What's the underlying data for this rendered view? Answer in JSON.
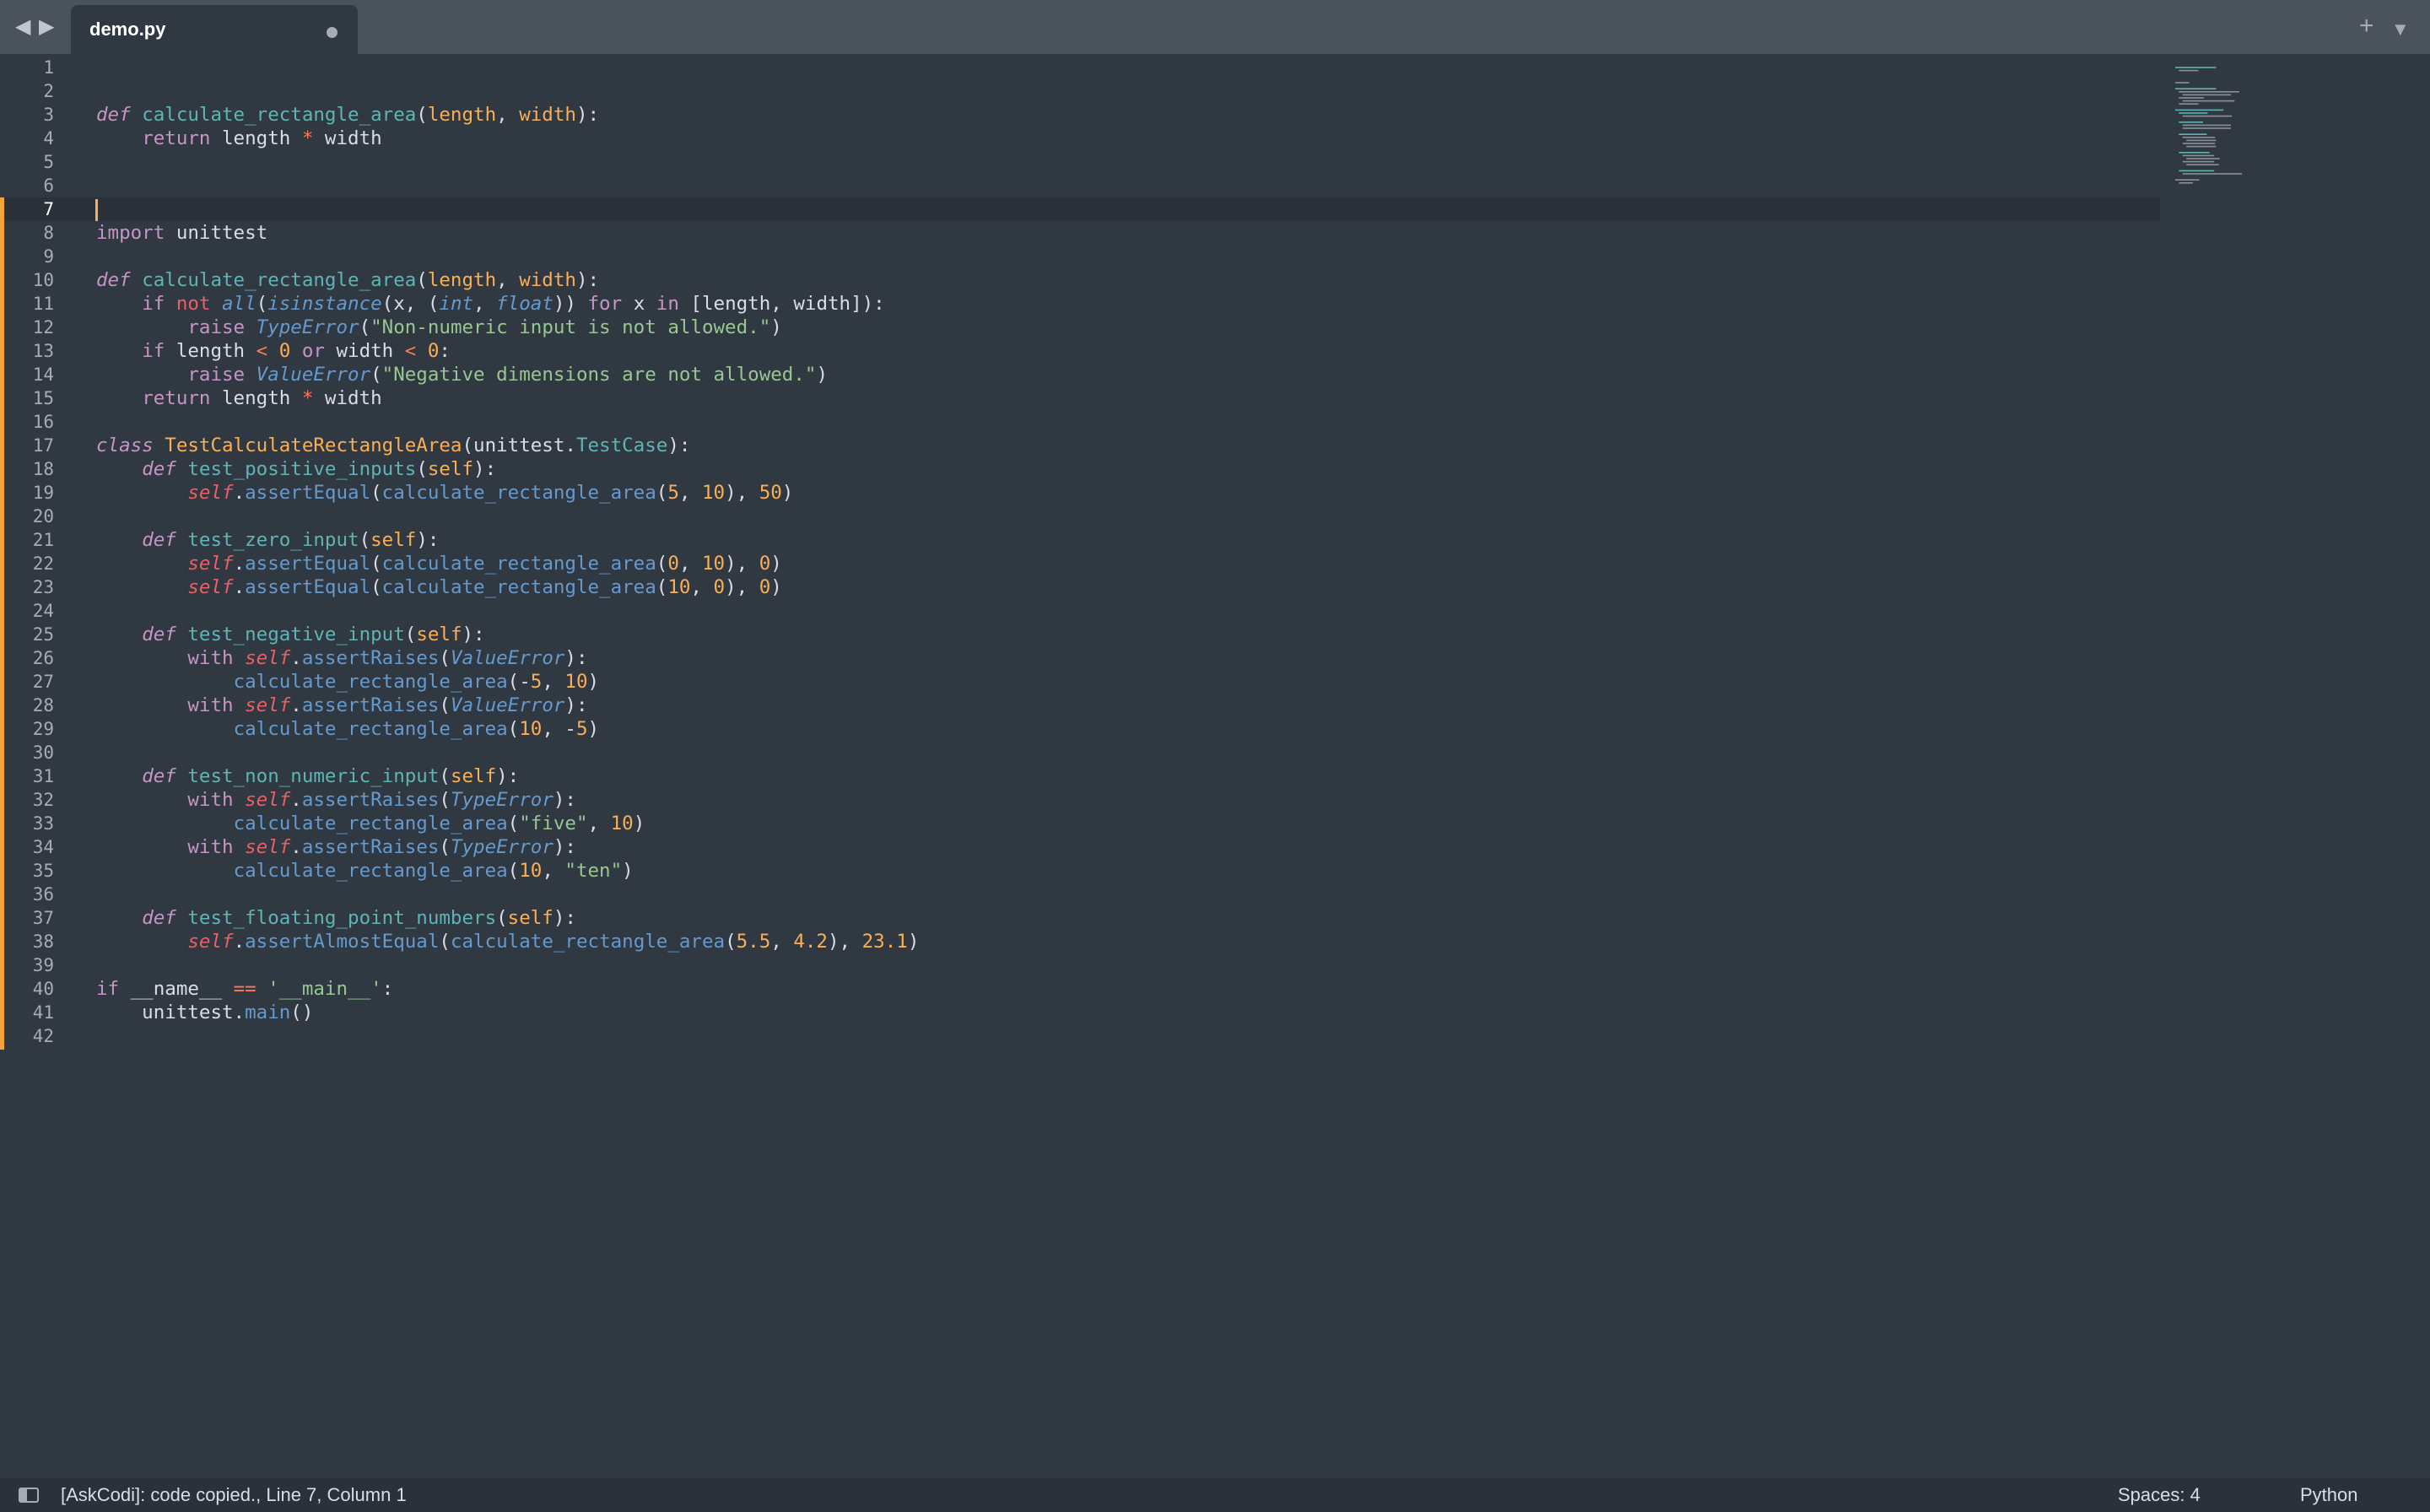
{
  "tabbar": {
    "back_icon": "◀",
    "forward_icon": "▶",
    "active_tab": {
      "title": "demo.py",
      "modified": true
    },
    "new_tab_icon": "+",
    "tab_menu_icon": "▼"
  },
  "editor": {
    "current_line": 7,
    "line_numbers": [
      "1",
      "2",
      "3",
      "4",
      "5",
      "6",
      "7",
      "8",
      "9",
      "10",
      "11",
      "12",
      "13",
      "14",
      "15",
      "16",
      "17",
      "18",
      "19",
      "20",
      "21",
      "22",
      "23",
      "24",
      "25",
      "26",
      "27",
      "28",
      "29",
      "30",
      "31",
      "32",
      "33",
      "34",
      "35",
      "36",
      "37",
      "38",
      "39",
      "40",
      "41",
      "42"
    ],
    "code": [
      "",
      "",
      "def calculate_rectangle_area(length, width):",
      "    return length * width",
      "",
      "",
      "",
      "import unittest",
      "",
      "def calculate_rectangle_area(length, width):",
      "    if not all(isinstance(x, (int, float)) for x in [length, width]):",
      "        raise TypeError(\"Non-numeric input is not allowed.\")",
      "    if length < 0 or width < 0:",
      "        raise ValueError(\"Negative dimensions are not allowed.\")",
      "    return length * width",
      "",
      "class TestCalculateRectangleArea(unittest.TestCase):",
      "    def test_positive_inputs(self):",
      "        self.assertEqual(calculate_rectangle_area(5, 10), 50)",
      "",
      "    def test_zero_input(self):",
      "        self.assertEqual(calculate_rectangle_area(0, 10), 0)",
      "        self.assertEqual(calculate_rectangle_area(10, 0), 0)",
      "",
      "    def test_negative_input(self):",
      "        with self.assertRaises(ValueError):",
      "            calculate_rectangle_area(-5, 10)",
      "        with self.assertRaises(ValueError):",
      "            calculate_rectangle_area(10, -5)",
      "",
      "    def test_non_numeric_input(self):",
      "        with self.assertRaises(TypeError):",
      "            calculate_rectangle_area(\"five\", 10)",
      "        with self.assertRaises(TypeError):",
      "            calculate_rectangle_area(10, \"ten\")",
      "",
      "    def test_floating_point_numbers(self):",
      "        self.assertAlmostEqual(calculate_rectangle_area(5.5, 4.2), 23.1)",
      "",
      "if __name__ == '__main__':",
      "    unittest.main()",
      ""
    ]
  },
  "statusbar": {
    "message": "[AskCodi]: code copied., Line 7, Column 1",
    "indentation": "Spaces: 4",
    "syntax": "Python"
  },
  "colors": {
    "background": "#303841",
    "tabbar": "#4a535c",
    "statusbar": "#2b3138",
    "modified_gutter": "#f3a33a",
    "caret": "#f9ae58"
  }
}
